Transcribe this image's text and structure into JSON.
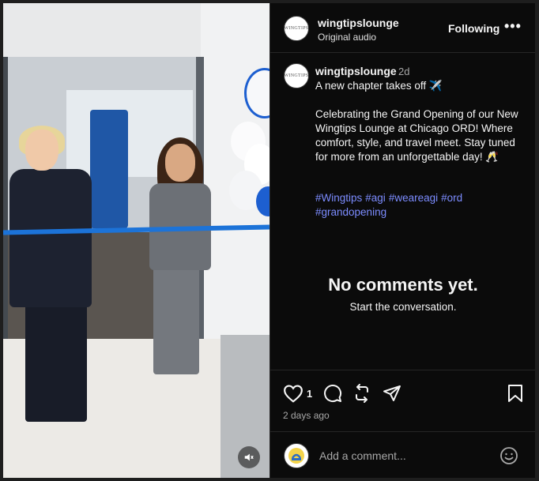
{
  "header": {
    "username": "wingtipslounge",
    "audio": "Original audio",
    "follow_label": "Following",
    "more_label": "•••"
  },
  "caption": {
    "username": "wingtipslounge",
    "time": "2d",
    "text": "A new chapter takes off ✈️\n\nCelebrating the Grand Opening of our New Wingtips Lounge at Chicago ORD! Where comfort, style, and travel meet. Stay tuned for more from an unforgettable day! 🥂",
    "hashtags": [
      "#Wingtips",
      "#agi",
      "#weareagi",
      "#ord",
      "#grandopening"
    ]
  },
  "comments": {
    "empty_title": "No comments yet.",
    "empty_subtitle": "Start the conversation."
  },
  "actions": {
    "like_count": "1",
    "time_ago": "2 days ago"
  },
  "add_comment": {
    "placeholder": "Add a comment..."
  },
  "avatar_text": "WINGTIPS",
  "colors": {
    "background": "#0b0b0b",
    "text": "#f5f5f5",
    "muted": "#a8a8a8",
    "hashtag": "#7c8cff",
    "ribbon": "#1c73d8"
  }
}
